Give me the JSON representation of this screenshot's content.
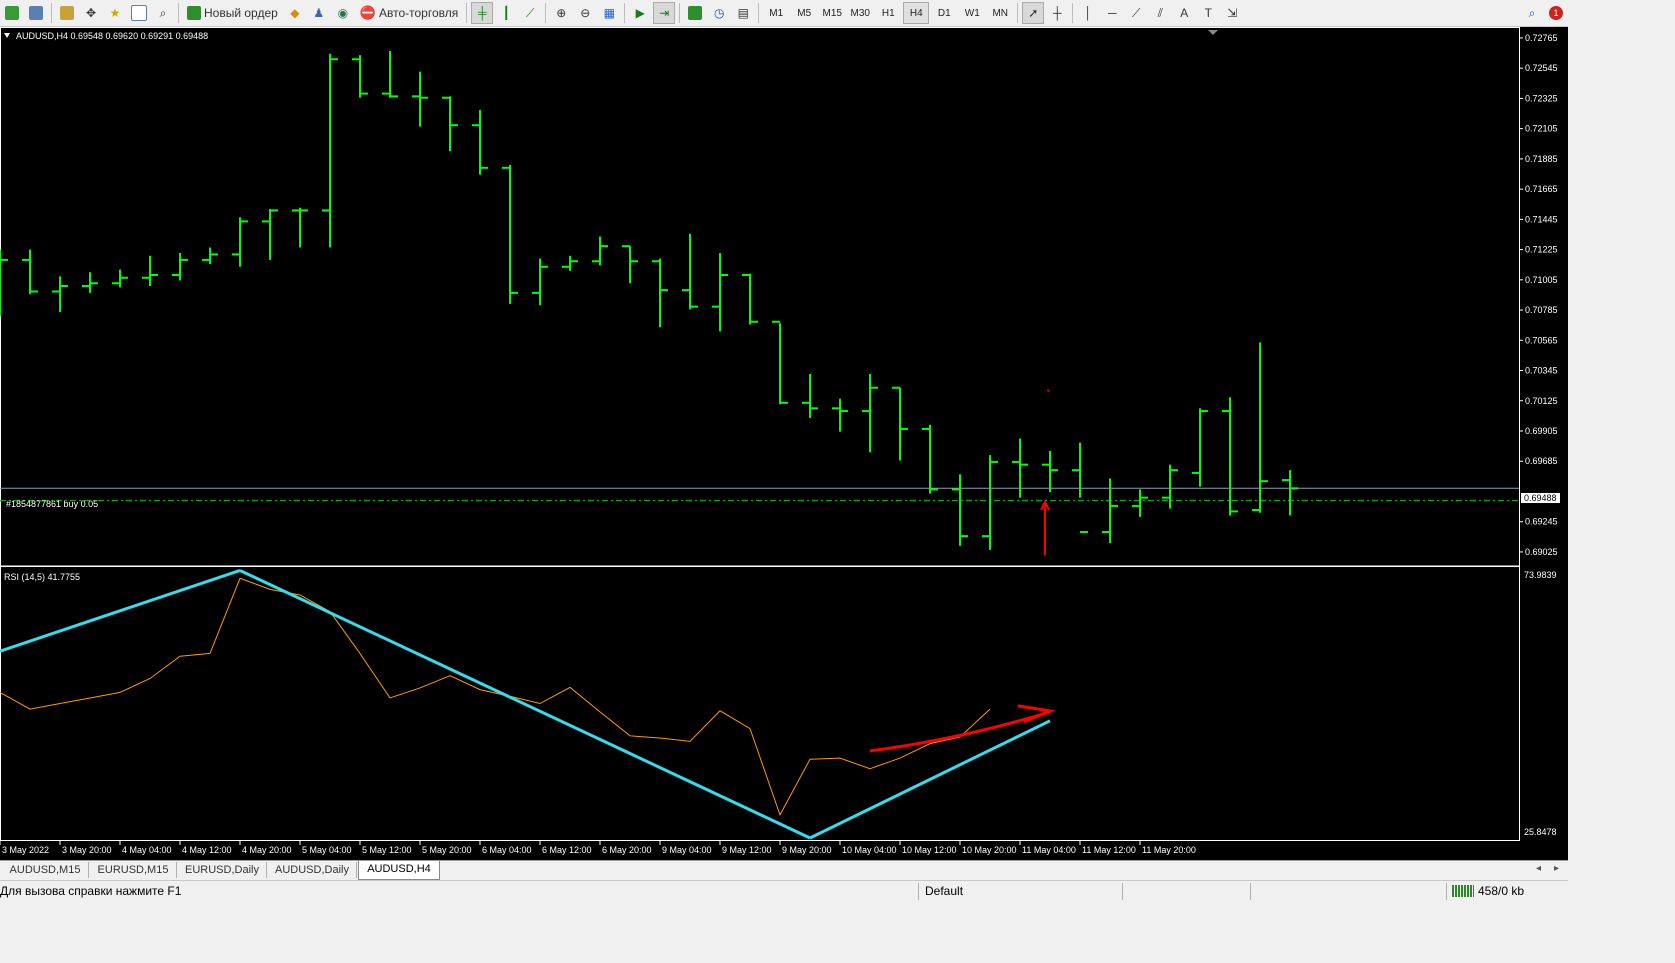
{
  "toolbar": {
    "new_order_label": "Новый ордер",
    "autotrading_label": "Авто-торговля",
    "timeframes": [
      "M1",
      "M5",
      "M15",
      "M30",
      "H1",
      "H4",
      "D1",
      "W1",
      "MN"
    ],
    "active_timeframe": "H4",
    "text_tool_label": "A",
    "notification_count": "1"
  },
  "chart": {
    "symbol_header": "AUDUSD,H4  0.69548 0.69620 0.69291 0.69488",
    "order_label": "#1854877861 buy 0.05",
    "current_price_label": "0.69488",
    "price_ticks": [
      "0.72765",
      "0.72545",
      "0.72325",
      "0.72105",
      "0.71885",
      "0.71665",
      "0.71445",
      "0.71225",
      "0.71005",
      "0.70785",
      "0.70565",
      "0.70345",
      "0.70125",
      "0.69905",
      "0.69685",
      "0.69245",
      "0.69025"
    ],
    "time_labels": [
      "3 May 2022",
      "3 May 20:00",
      "4 May 04:00",
      "4 May 12:00",
      "4 May 20:00",
      "5 May 04:00",
      "5 May 12:00",
      "5 May 20:00",
      "6 May 04:00",
      "6 May 12:00",
      "6 May 20:00",
      "9 May 04:00",
      "9 May 12:00",
      "9 May 20:00",
      "10 May 04:00",
      "10 May 12:00",
      "10 May 20:00",
      "11 May 04:00",
      "11 May 12:00",
      "11 May 20:00"
    ],
    "rsi_label": "RSI (14,5) 41.7755",
    "rsi_max_label": "73.9839",
    "rsi_min_label": "25.8478",
    "colors": {
      "background": "#000000",
      "bars": "#00ff00",
      "rsi": "#ff9900",
      "trendline": "#33ddee",
      "annotation": "#ff0000",
      "bid_line": "#8aa0b8"
    }
  },
  "chart_data": {
    "type": "ohlc",
    "symbol": "AUDUSD",
    "timeframe": "H4",
    "header_ohlc": {
      "open": 0.69548,
      "high": 0.6962,
      "low": 0.69291,
      "close": 0.69488
    },
    "ylim": [
      0.6893,
      0.7283
    ],
    "bars": [
      [
        0.7115,
        0.71225,
        0.7074,
        0.7115
      ],
      [
        0.7115,
        0.71225,
        0.709,
        0.7092
      ],
      [
        0.7092,
        0.7103,
        0.7077,
        0.7096
      ],
      [
        0.7096,
        0.7106,
        0.7091,
        0.7098
      ],
      [
        0.7098,
        0.7108,
        0.7095,
        0.7102
      ],
      [
        0.7102,
        0.7118,
        0.7096,
        0.7104
      ],
      [
        0.7104,
        0.712,
        0.71,
        0.7115
      ],
      [
        0.7115,
        0.7124,
        0.7112,
        0.7119
      ],
      [
        0.7119,
        0.7146,
        0.711,
        0.7143
      ],
      [
        0.7143,
        0.7152,
        0.7115,
        0.7151
      ],
      [
        0.7151,
        0.7153,
        0.7124,
        0.7151
      ],
      [
        0.7151,
        0.7265,
        0.7124,
        0.7261
      ],
      [
        0.7261,
        0.7264,
        0.7233,
        0.7236
      ],
      [
        0.7236,
        0.7267,
        0.7233,
        0.7234
      ],
      [
        0.7234,
        0.7252,
        0.7212,
        0.7233
      ],
      [
        0.7233,
        0.7234,
        0.7194,
        0.7213
      ],
      [
        0.7213,
        0.7224,
        0.7177,
        0.7182
      ],
      [
        0.7182,
        0.7184,
        0.7083,
        0.7091
      ],
      [
        0.7091,
        0.7116,
        0.7082,
        0.711
      ],
      [
        0.711,
        0.7118,
        0.7107,
        0.7114
      ],
      [
        0.7114,
        0.7132,
        0.7111,
        0.7125
      ],
      [
        0.7125,
        0.7125,
        0.7098,
        0.7114
      ],
      [
        0.7114,
        0.7116,
        0.7066,
        0.7093
      ],
      [
        0.7093,
        0.7134,
        0.7079,
        0.7081
      ],
      [
        0.7081,
        0.712,
        0.7063,
        0.7104
      ],
      [
        0.7104,
        0.7105,
        0.7068,
        0.707
      ],
      [
        0.707,
        0.7069,
        0.701,
        0.7011
      ],
      [
        0.7011,
        0.7032,
        0.7,
        0.7007
      ],
      [
        0.7007,
        0.7014,
        0.699,
        0.7005
      ],
      [
        0.7005,
        0.7032,
        0.6975,
        0.7022
      ],
      [
        0.7022,
        0.7022,
        0.6969,
        0.6992
      ],
      [
        0.6992,
        0.6995,
        0.6945,
        0.6948
      ],
      [
        0.6948,
        0.6959,
        0.6907,
        0.6914
      ],
      [
        0.6914,
        0.6973,
        0.6904,
        0.6968
      ],
      [
        0.6968,
        0.6985,
        0.6942,
        0.6966
      ],
      [
        0.6966,
        0.6976,
        0.6946,
        0.6962
      ],
      [
        0.6962,
        0.6982,
        0.6942,
        0.6917
      ],
      [
        0.6917,
        0.6956,
        0.6909,
        0.6936
      ],
      [
        0.6936,
        0.6948,
        0.6928,
        0.6942
      ],
      [
        0.6942,
        0.6966,
        0.6934,
        0.6962
      ],
      [
        0.696,
        0.7007,
        0.695,
        0.7005
      ],
      [
        0.7005,
        0.7015,
        0.6929,
        0.6932
      ],
      [
        0.6933,
        0.7055,
        0.6931,
        0.6954
      ],
      [
        0.69548,
        0.6962,
        0.69291,
        0.69488
      ]
    ],
    "rsi": {
      "name": "RSI (14,5)",
      "last_value": 41.7755,
      "ylim": [
        25.8478,
        73.9839
      ],
      "values": [
        52.0,
        49.0,
        50.0,
        51.0,
        52.0,
        54.5,
        58.5,
        59.0,
        72.5,
        70.5,
        69.5,
        66.5,
        59.0,
        51.0,
        52.8,
        55.0,
        52.5,
        51.3,
        50.0,
        52.9,
        48.5,
        44.2,
        43.8,
        43.2,
        48.7,
        45.5,
        30.0,
        40.0,
        40.2,
        38.3,
        40.2,
        42.8,
        44.0,
        49.0
      ],
      "values_start_index": 1
    },
    "trendlines": [
      {
        "from": [
          0,
          59.4
        ],
        "to": [
          8,
          73.9
        ]
      },
      {
        "from": [
          8,
          73.9
        ],
        "to": [
          27,
          25.85
        ]
      },
      {
        "from": [
          27,
          25.85
        ],
        "to": [
          35,
          46.9
        ]
      }
    ],
    "order_line": {
      "label": "#1854877861 buy 0.05",
      "price": 0.694
    },
    "bid_price": 0.69488
  },
  "tabs": {
    "items": [
      {
        "label": "AUDUSD,M15",
        "active": false
      },
      {
        "label": "EURUSD,M15",
        "active": false
      },
      {
        "label": "EURUSD,Daily",
        "active": false
      },
      {
        "label": "AUDUSD,Daily",
        "active": false
      },
      {
        "label": "AUDUSD,H4",
        "active": true
      }
    ]
  },
  "status": {
    "help_text": "Для вызова справки нажмите F1",
    "profile": "Default",
    "traffic": "458/0 kb"
  }
}
